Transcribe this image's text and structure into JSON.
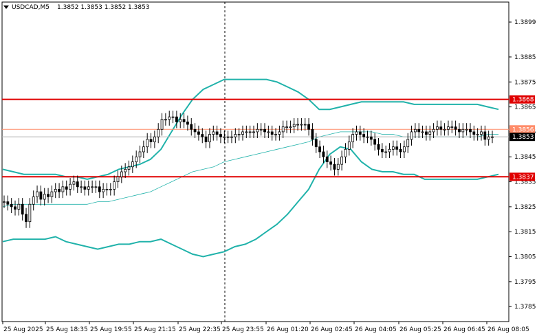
{
  "header": {
    "symbol": "USDCAD,M5",
    "ohlc": "1.3852 1.3853 1.3852 1.3853"
  },
  "colors": {
    "candle": "#000000",
    "bollinger": "#20b2aa",
    "ma": "#20b2aa",
    "level_line": "#e00000",
    "current_line": "#ff8c69",
    "bid_line": "#b4b4b4",
    "grid": "#000000"
  },
  "chart_data": {
    "type": "candlestick",
    "title": "",
    "ylim": [
      1.3779,
      1.3907
    ],
    "x_categories": [
      "25 Aug 2025",
      "25 Aug 18:35",
      "25 Aug 19:55",
      "25 Aug 21:15",
      "25 Aug 22:35",
      "25 Aug 23:55",
      "26 Aug 01:20",
      "26 Aug 02:45",
      "26 Aug 04:05",
      "26 Aug 05:25",
      "26 Aug 06:45",
      "26 Aug 08:05"
    ],
    "y_ticks": [
      "1.3899",
      "1.3885",
      "1.3875",
      "1.3865",
      "1.3855",
      "1.3845",
      "1.3835",
      "1.3825",
      "1.3815",
      "1.3805",
      "1.3795",
      "1.3785"
    ],
    "levels": [
      {
        "label": "1.3868",
        "value": 1.3868,
        "style": "red-line"
      },
      {
        "label": "1.3856",
        "value": 1.3856,
        "style": "current"
      },
      {
        "label": "1.3853",
        "value": 1.3853,
        "style": "bid"
      },
      {
        "label": "1.3837",
        "value": 1.3837,
        "style": "red-line"
      }
    ],
    "series": [
      {
        "name": "close",
        "values": [
          1.3827,
          1.3826,
          1.3825,
          1.3824,
          1.3826,
          1.3822,
          1.3819,
          1.3826,
          1.3829,
          1.3831,
          1.3828,
          1.383,
          1.3829,
          1.3831,
          1.3832,
          1.3831,
          1.3833,
          1.3832,
          1.3834,
          1.3835,
          1.3833,
          1.3833,
          1.3832,
          1.3833,
          1.3833,
          1.3833,
          1.3831,
          1.3832,
          1.3832,
          1.3832,
          1.3835,
          1.3837,
          1.3839,
          1.384,
          1.3841,
          1.3843,
          1.3845,
          1.3847,
          1.3849,
          1.3852,
          1.3851,
          1.3853,
          1.3856,
          1.386,
          1.386,
          1.3861,
          1.3861,
          1.3859,
          1.386,
          1.3859,
          1.3858,
          1.3856,
          1.3855,
          1.3854,
          1.3853,
          1.3851,
          1.3854,
          1.3855,
          1.3854,
          1.3853,
          1.3853,
          1.3853,
          1.3853,
          1.3854,
          1.3854,
          1.3855,
          1.3855,
          1.3855,
          1.3855,
          1.3856,
          1.3856,
          1.3855,
          1.3855,
          1.3854,
          1.3854,
          1.3855,
          1.3857,
          1.3857,
          1.3857,
          1.3858,
          1.3858,
          1.3858,
          1.3858,
          1.3856,
          1.3852,
          1.3849,
          1.3847,
          1.3845,
          1.3843,
          1.3842,
          1.384,
          1.3842,
          1.3845,
          1.3848,
          1.3851,
          1.3854,
          1.3855,
          1.3854,
          1.3853,
          1.3853,
          1.3852,
          1.385,
          1.3848,
          1.3847,
          1.3847,
          1.3848,
          1.3849,
          1.3848,
          1.3847,
          1.3849,
          1.3852,
          1.3855,
          1.3856,
          1.3855,
          1.3855,
          1.3854,
          1.3855,
          1.3856,
          1.3857,
          1.3856,
          1.3856,
          1.3857,
          1.3857,
          1.3856,
          1.3855,
          1.3856,
          1.3856,
          1.3855,
          1.3854,
          1.3854,
          1.3855,
          1.3852,
          1.3853,
          1.3853
        ]
      },
      {
        "name": "bb_upper",
        "values": [
          1.384,
          1.3839,
          1.3838,
          1.3838,
          1.3838,
          1.3838,
          1.3837,
          1.3837,
          1.3836,
          1.3837,
          1.3838,
          1.384,
          1.3841,
          1.3842,
          1.3844,
          1.3848,
          1.3855,
          1.3862,
          1.3868,
          1.3872,
          1.3874,
          1.3876,
          1.3876,
          1.3876,
          1.3876,
          1.3876,
          1.3875,
          1.3873,
          1.3871,
          1.3868,
          1.3864,
          1.3864,
          1.3865,
          1.3866,
          1.3867,
          1.3867,
          1.3867,
          1.3867,
          1.3867,
          1.3866,
          1.3866,
          1.3866,
          1.3866,
          1.3866,
          1.3866,
          1.3866,
          1.3865,
          1.3864
        ]
      },
      {
        "name": "bb_lower",
        "values": [
          1.3811,
          1.3812,
          1.3812,
          1.3812,
          1.3812,
          1.3813,
          1.3811,
          1.381,
          1.3809,
          1.3808,
          1.3809,
          1.381,
          1.381,
          1.3811,
          1.3811,
          1.3812,
          1.381,
          1.3808,
          1.3806,
          1.3805,
          1.3806,
          1.3807,
          1.3809,
          1.381,
          1.3812,
          1.3815,
          1.3818,
          1.3822,
          1.3827,
          1.3832,
          1.384,
          1.3846,
          1.3849,
          1.3848,
          1.3843,
          1.384,
          1.3839,
          1.3839,
          1.3838,
          1.3838,
          1.3836,
          1.3836,
          1.3836,
          1.3836,
          1.3836,
          1.3836,
          1.3837,
          1.3838
        ]
      },
      {
        "name": "ma",
        "values": [
          1.3825,
          1.3826,
          1.3826,
          1.3826,
          1.3826,
          1.3826,
          1.3826,
          1.3826,
          1.3826,
          1.3827,
          1.3827,
          1.3828,
          1.3829,
          1.383,
          1.3831,
          1.3833,
          1.3835,
          1.3837,
          1.3839,
          1.384,
          1.3841,
          1.3843,
          1.3844,
          1.3845,
          1.3846,
          1.3847,
          1.3848,
          1.3849,
          1.385,
          1.3851,
          1.3853,
          1.3854,
          1.3855,
          1.3855,
          1.3855,
          1.3855,
          1.3854,
          1.3854,
          1.3853,
          1.3853,
          1.3853,
          1.3853,
          1.3853,
          1.3853,
          1.3853,
          1.3853,
          1.3854,
          1.3854
        ]
      }
    ]
  }
}
